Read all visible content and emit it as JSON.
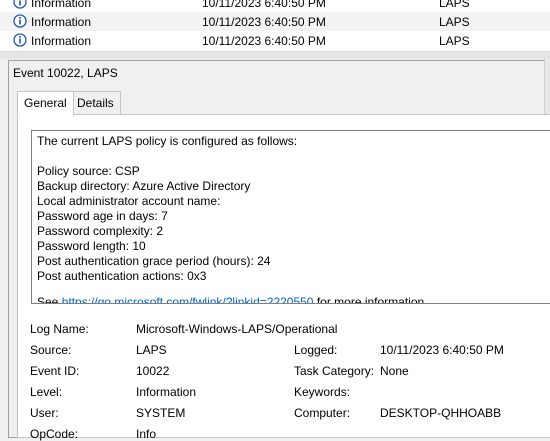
{
  "event_list": [
    {
      "level": "Information",
      "date": "10/11/2023 6:40:50 PM",
      "source": "LAPS"
    },
    {
      "level": "Information",
      "date": "10/11/2023 6:40:50 PM",
      "source": "LAPS"
    },
    {
      "level": "Information",
      "date": "10/11/2023 6:40:50 PM",
      "source": "LAPS"
    }
  ],
  "details": {
    "title": "Event 10022, LAPS",
    "tabs": [
      "General",
      "Details"
    ],
    "active_tab": "General",
    "message": {
      "intro": "The current LAPS policy is configured as follows:",
      "lines": [
        "Policy source: CSP",
        "Backup directory: Azure Active Directory",
        "Local administrator account name:",
        "Password age in days: 7",
        "Password complexity: 2",
        "Password length: 10",
        "Post authentication grace period (hours): 24",
        "Post authentication actions: 0x3"
      ],
      "see_prefix": "See ",
      "link_text": "https://go.microsoft.com/fwlink/?linkid=2220550",
      "see_suffix": " for more information."
    },
    "fields": {
      "log_name_label": "Log Name:",
      "log_name_value": "Microsoft-Windows-LAPS/Operational",
      "source_label": "Source:",
      "source_value": "LAPS",
      "logged_label": "Logged:",
      "logged_value": "10/11/2023 6:40:50 PM",
      "event_id_label": "Event ID:",
      "event_id_value": "10022",
      "task_category_label": "Task Category:",
      "task_category_value": "None",
      "level_label": "Level:",
      "level_value": "Information",
      "keywords_label": "Keywords:",
      "keywords_value": "",
      "user_label": "User:",
      "user_value": "SYSTEM",
      "computer_label": "Computer:",
      "computer_value": "DESKTOP-QHHOABB",
      "opcode_label": "OpCode:",
      "opcode_value": "Info"
    }
  },
  "colors": {
    "info_icon": "#1e5aa8",
    "link": "#0066cc"
  }
}
